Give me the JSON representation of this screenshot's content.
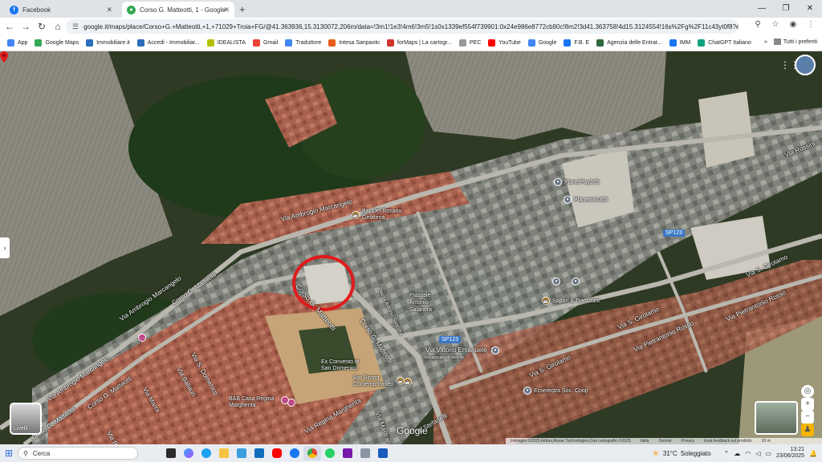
{
  "browser": {
    "tabs": [
      {
        "title": "Facebook",
        "icon": "facebook-icon"
      },
      {
        "title": "Corso G. Matteotti, 1 - Google",
        "icon": "maps-icon"
      }
    ],
    "url": "google.it/maps/place/Corso+G.+Matteotti,+1,+71029+Troia+FG/@41.363936,15.3130072,206m/data=!3m1!1e3!4m6!3m5!1s0x1339ef554f739901:0x24e986e8772cb90c!8m2!3d41.363758!4d15.3124554!16s%2Fg%2F11c43yt0f8?entry=ttu&g_ep=E...",
    "bookmarks": [
      "App",
      "Google Maps",
      "Immobiliare.it",
      "Accedi - Immobiliar...",
      "IDEALISTA",
      "Gmail",
      "Traduttore",
      "Intesa Sanpaolo",
      "forMaps | La cartogr...",
      "PEC",
      "YouTube",
      "Google",
      "F.B. E",
      "Agenzia delle Entrat...",
      "IMM",
      "ChatGPT Italiano"
    ],
    "bookmarks_right": "Tutti i preferiti"
  },
  "map": {
    "streets": [
      {
        "name": "Via Ambrogio Marcangelo",
        "id": "a"
      },
      {
        "name": "Via Ambrogio Marcangelo",
        "id": "b"
      },
      {
        "name": "Corso G. Matteotti",
        "id": "c"
      },
      {
        "name": "Corso G. Matteotti",
        "id": "d"
      },
      {
        "name": "Corso G. Matteotti",
        "id": "e"
      },
      {
        "name": "Via S. Domenico",
        "id": "f"
      },
      {
        "name": "Via Ballauri",
        "id": "g"
      },
      {
        "name": "Via Marra",
        "id": "h"
      },
      {
        "name": "Via Regina Margherita",
        "id": "i"
      },
      {
        "name": "Via Mastrandrea",
        "id": "j"
      },
      {
        "name": "V. Stefanelli",
        "id": "k"
      },
      {
        "name": "Via S. Girolamo",
        "id": "l"
      },
      {
        "name": "Via S. Girolamo",
        "id": "m"
      },
      {
        "name": "Via S. Girolamo",
        "id": "n"
      },
      {
        "name": "Via Pietrantonio Rosso",
        "id": "o"
      },
      {
        "name": "Via Pietrantonio Rosso",
        "id": "p"
      },
      {
        "name": "Via Rossini",
        "id": "q"
      },
      {
        "name": "Via Vittorio Emanuele, 1",
        "id": "r"
      },
      {
        "name": "Via Rossi",
        "id": "s"
      },
      {
        "name": "Corso G. Matteotti",
        "id": "t"
      },
      {
        "name": "Piazza Antonio Salandra",
        "id": "u"
      }
    ],
    "pois": [
      {
        "name": "Piazzale Antonio Salandra",
        "color": "#ffffff"
      },
      {
        "name": "Bar Bistrot Contemporaneo",
        "color": "#f29900"
      },
      {
        "name": "Ex Convento di San Domenico",
        "color": "#7a8a99"
      },
      {
        "name": "B&B Casa Regina Margherita",
        "color": "#d53f8c"
      },
      {
        "name": "Sapori & Tradizioni",
        "color": "#f29900"
      },
      {
        "name": "PlanetPay365",
        "color": "#7a8a99"
      },
      {
        "name": "Planetwin365",
        "color": "#7a8a99"
      },
      {
        "name": "Ecoelectra Soc. Coop",
        "color": "#7a8a99"
      },
      {
        "name": "Bar Del Rosario Gelateria",
        "color": "#f29900"
      },
      {
        "name": "Via Vittorio Emanuele, 1",
        "sub": "Visualizzato di recente",
        "color": "#7a8a99"
      }
    ],
    "shields": [
      "SP123",
      "SP123"
    ],
    "pin_label": "Corso G. Matteotti",
    "layers_label": "Livelli",
    "google_logo": "Google",
    "attribution": [
      "Immagini ©2025 Airbus,Maxar Technologies,Dati cartografici ©2025",
      "Italia",
      "Termini",
      "Privacy",
      "Invia feedback sul prodotto",
      "20 m"
    ]
  },
  "taskbar": {
    "search": "Cerca",
    "weather_temp": "31°C",
    "weather_text": "Soleggiato",
    "time": "13:21",
    "date": "23/06/2025"
  },
  "colors": {
    "pin": "#e01b1b",
    "accent": "#1a73e8"
  }
}
